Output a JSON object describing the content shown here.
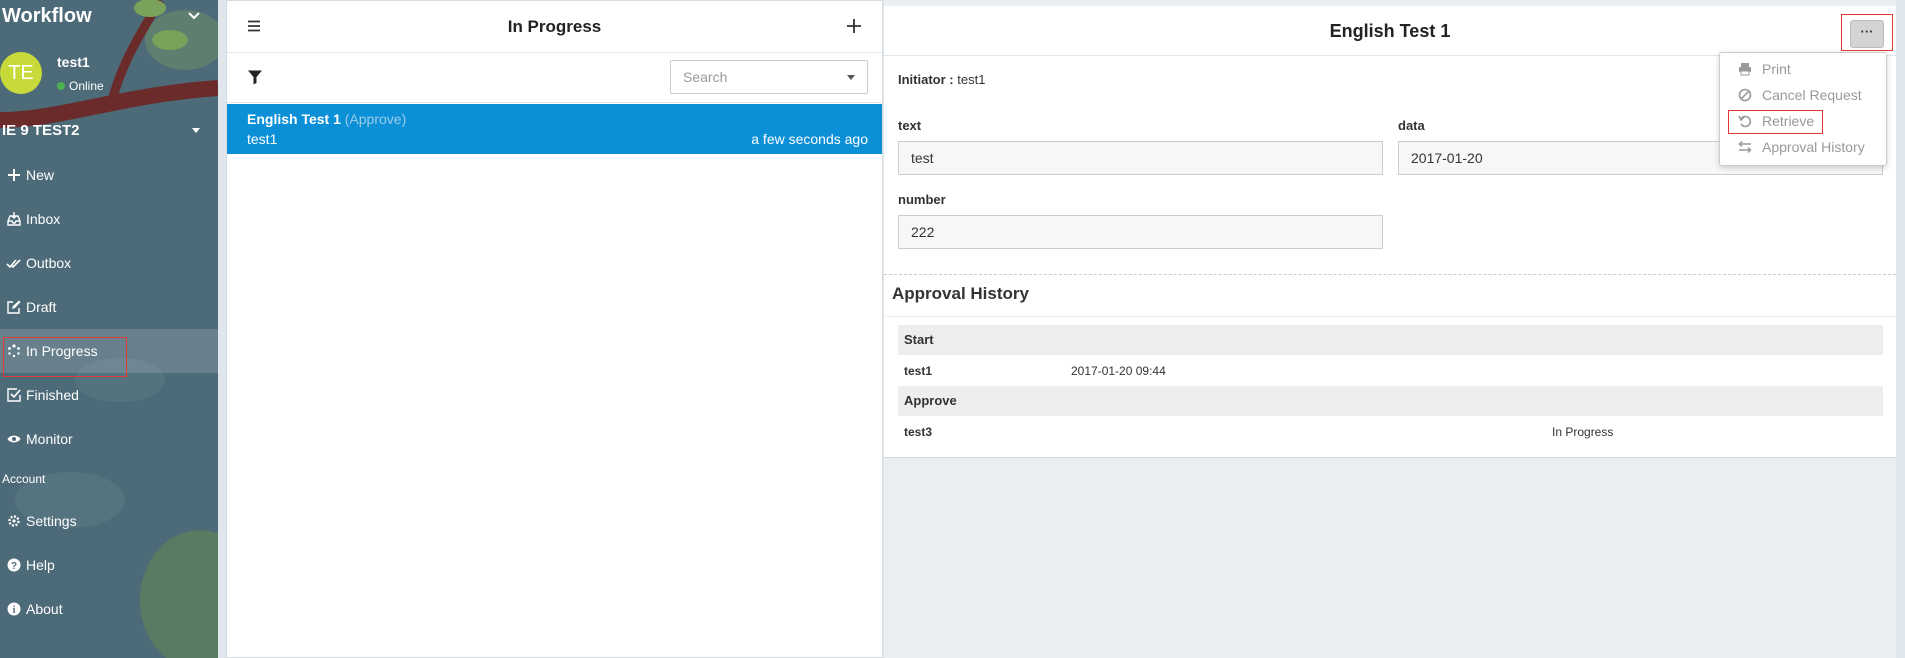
{
  "sidebar": {
    "app_title": "Workflow",
    "user": {
      "initials": "TE",
      "name": "test1",
      "status": "Online"
    },
    "org": "IE 9 TEST2",
    "nav": [
      {
        "label": "New",
        "icon": "plus-icon"
      },
      {
        "label": "Inbox",
        "icon": "inbox-icon"
      },
      {
        "label": "Outbox",
        "icon": "double-check-icon"
      },
      {
        "label": "Draft",
        "icon": "edit-icon"
      },
      {
        "label": "In Progress",
        "icon": "spinner-icon"
      },
      {
        "label": "Finished",
        "icon": "check-square-icon"
      },
      {
        "label": "Monitor",
        "icon": "eye-icon"
      }
    ],
    "account_label": "Account",
    "account_nav": [
      {
        "label": "Settings",
        "icon": "gear-icon"
      },
      {
        "label": "Help",
        "icon": "question-circle-icon"
      },
      {
        "label": "About",
        "icon": "info-circle-icon"
      }
    ]
  },
  "list_panel": {
    "title": "In Progress",
    "search_placeholder": "Search",
    "items": [
      {
        "title": "English Test 1",
        "status": "(Approve)",
        "user": "test1",
        "time": "a few seconds ago"
      }
    ]
  },
  "detail": {
    "title": "English Test 1",
    "more_label": "···",
    "initiator_label": "Initiator :",
    "initiator_value": "test1",
    "fields": {
      "text": {
        "label": "text",
        "value": "test"
      },
      "data": {
        "label": "data",
        "value": "2017-01-20"
      },
      "number": {
        "label": "number",
        "value": "222"
      }
    },
    "approval_history": {
      "title": "Approval History",
      "steps": [
        {
          "name": "Start",
          "user": "test1",
          "time": "2017-01-20 09:44",
          "status": ""
        },
        {
          "name": "Approve",
          "user": "test3",
          "time": "",
          "status": "In Progress"
        }
      ]
    }
  },
  "menu": {
    "items": [
      {
        "label": "Print",
        "icon": "print-icon"
      },
      {
        "label": "Cancel Request",
        "icon": "ban-icon"
      },
      {
        "label": "Retrieve",
        "icon": "undo-icon"
      },
      {
        "label": "Approval History",
        "icon": "history-icon"
      }
    ]
  },
  "colors": {
    "sidebar_bg": "#4d6a78",
    "selected_item_bg": "#0b8fd6",
    "avatar_bg": "#c8d93a",
    "online_dot": "#4caf50",
    "highlight_border": "#e53935"
  }
}
